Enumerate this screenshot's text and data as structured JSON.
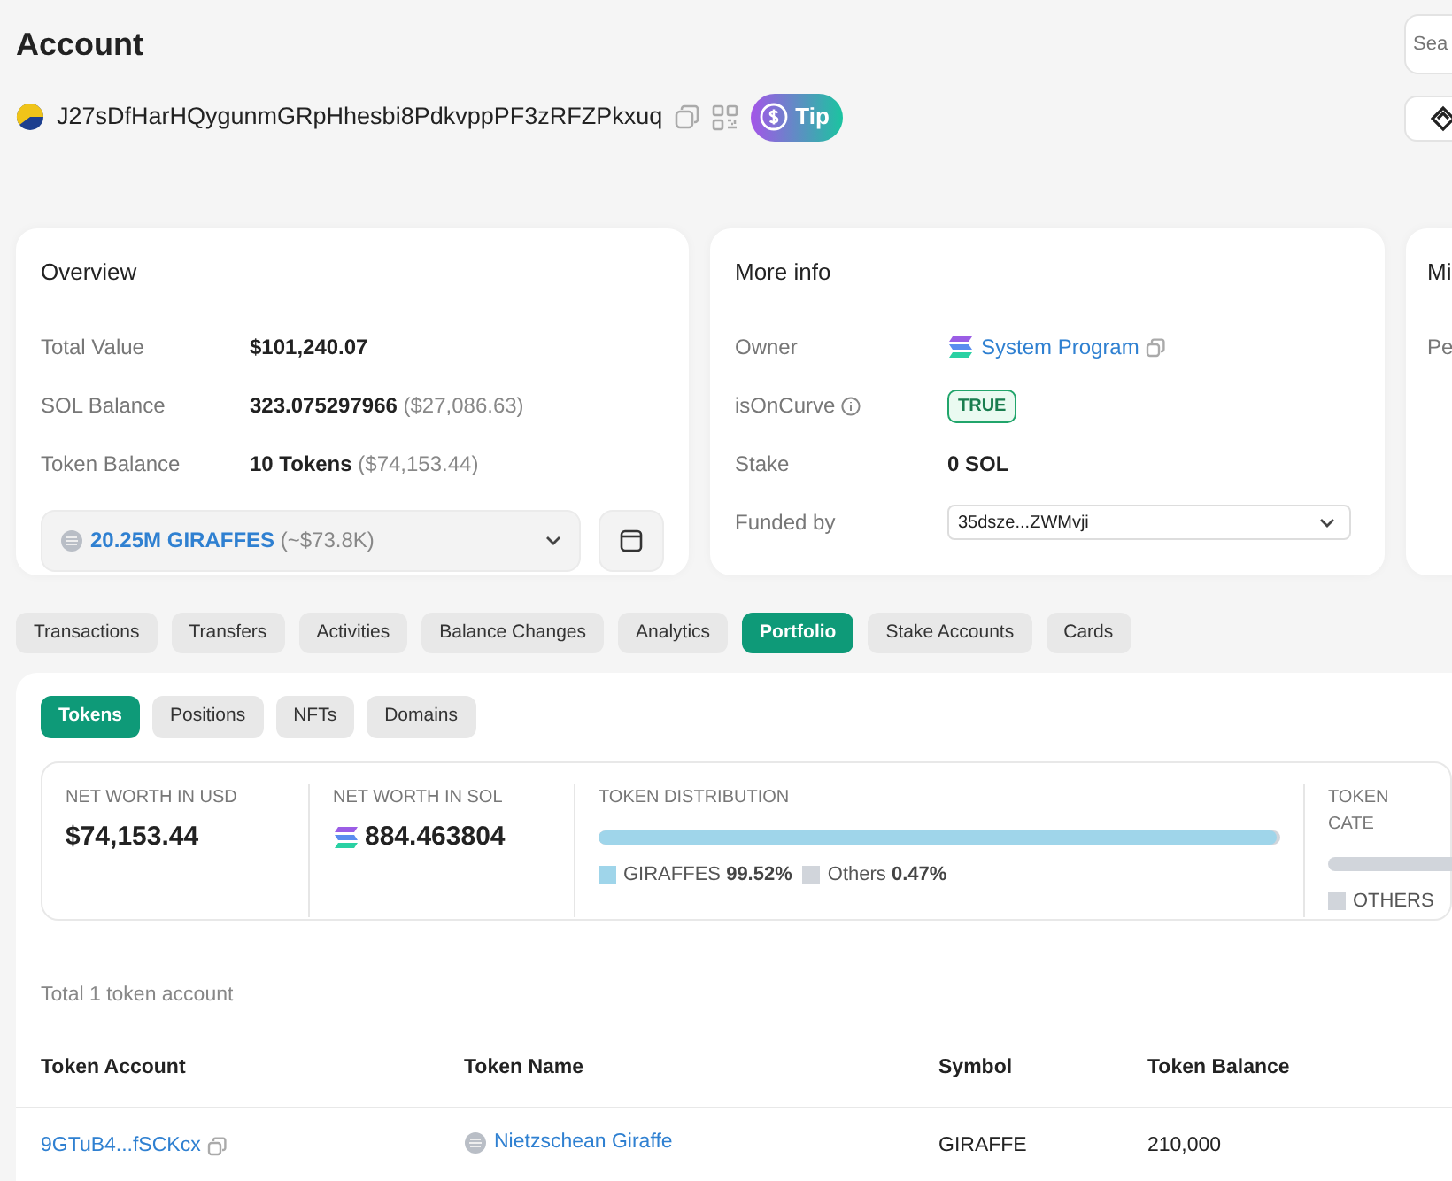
{
  "page": {
    "title": "Account",
    "search": {
      "placeholder": "Sea"
    }
  },
  "address": {
    "value": "J27sDfHarHQygunmGRpHhesbi8PdkvppPF3zRFZPkxuq",
    "tip_label": "Tip"
  },
  "overview": {
    "title": "Overview",
    "rows": [
      {
        "label": "Total Value",
        "value": "$101,240.07"
      },
      {
        "label": "SOL Balance",
        "value": "323.075297966",
        "note": "($27,086.63)"
      },
      {
        "label": "Token Balance",
        "value": "10 Tokens",
        "note": "($74,153.44)"
      }
    ],
    "token_select": {
      "amount": "20.25M GIRAFFES",
      "note": "(~$73.8K)"
    }
  },
  "more_info": {
    "title": "More info",
    "rows": [
      {
        "kind": "link",
        "label": "Owner",
        "value": "System Program"
      },
      {
        "kind": "badge",
        "label": "isOnCurve",
        "value": "TRUE"
      },
      {
        "kind": "text",
        "label": "Stake",
        "value": "0 SOL"
      },
      {
        "kind": "select",
        "label": "Funded by",
        "value": "35dsze...ZWMvji"
      }
    ]
  },
  "third_card": {
    "title": "Mi",
    "label": "Pe"
  },
  "tabs": [
    {
      "label": "Transactions",
      "selected": false
    },
    {
      "label": "Transfers",
      "selected": false
    },
    {
      "label": "Activities",
      "selected": false
    },
    {
      "label": "Balance Changes",
      "selected": false
    },
    {
      "label": "Analytics",
      "selected": false
    },
    {
      "label": "Portfolio",
      "selected": true
    },
    {
      "label": "Stake Accounts",
      "selected": false
    },
    {
      "label": "Cards",
      "selected": false
    }
  ],
  "sub_tabs": [
    {
      "label": "Tokens",
      "selected": true
    },
    {
      "label": "Positions",
      "selected": false
    },
    {
      "label": "NFTs",
      "selected": false
    },
    {
      "label": "Domains",
      "selected": false
    }
  ],
  "stats": {
    "usd": {
      "label": "NET WORTH IN USD",
      "value": "$74,153.44"
    },
    "sol": {
      "label": "NET WORTH IN SOL",
      "value": "884.463804"
    },
    "distribution": {
      "label": "TOKEN DISTRIBUTION",
      "level": 0.9952,
      "legend": [
        {
          "name": "GIRAFFES",
          "value": "99.52%",
          "color": "#9fd5ea"
        },
        {
          "name": "Others",
          "value": "0.47%",
          "color": "#d1d5db"
        }
      ]
    },
    "category": {
      "label": "TOKEN CATE",
      "legend": [
        {
          "name": "OTHERS",
          "color": "#d1d5db"
        }
      ]
    }
  },
  "table": {
    "total": "Total 1 token account",
    "columns": [
      "Token Account",
      "Token Name",
      "Symbol",
      "Token Balance"
    ],
    "rows": [
      {
        "token_account": "9GTuB4...fSCKcx",
        "token_name": "Nietzschean Giraffe",
        "symbol": "GIRAFFE",
        "token_balance": "210,000"
      }
    ]
  }
}
